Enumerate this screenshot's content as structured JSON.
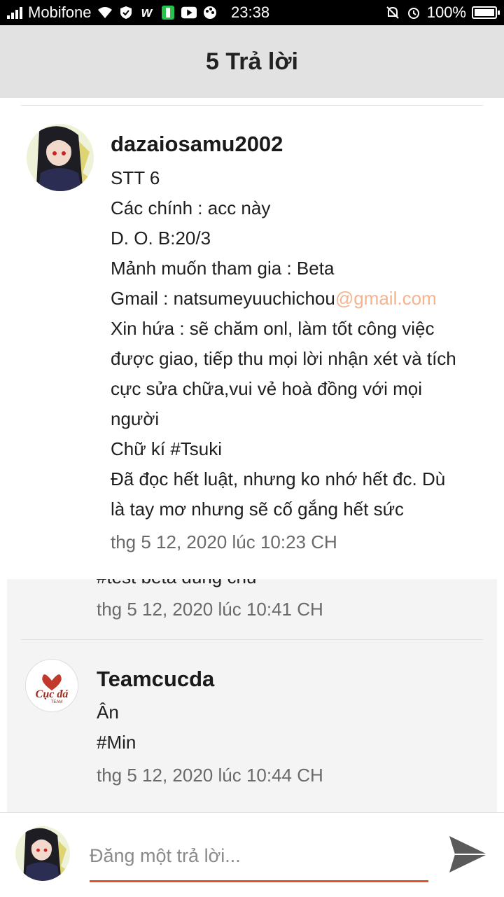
{
  "status_bar": {
    "carrier": "Mobifone",
    "time": "23:38",
    "battery": "100%"
  },
  "header": {
    "title": "5 Trả lời"
  },
  "comments": [
    {
      "author": "dazaiosamu2002",
      "lines": [
        "STT 6",
        "Các chính : acc này",
        "D. O. B:20/3",
        "Mảnh muốn tham gia : Beta",
        "Xin hứa : sẽ chăm onl, làm tốt công việc",
        "được giao, tiếp thu mọi lời nhận xét và tích",
        "cực sửa chữa,vui vẻ hoà đồng với mọi",
        "người",
        "Chữ kí #Tsuki",
        "Đã đọc hết luật, nhưng ko nhớ hết đc. Dù",
        "là tay mơ nhưng sẽ cố gắng hết sức"
      ],
      "email_prefix": "Gmail : natsumeyuuchichou",
      "email_domain": "@gmail.com",
      "date": "thg 5 12, 2020 lúc 10:23 CH"
    },
    {
      "partial_text": "#test beta dùng chủ",
      "date": "thg 5 12, 2020 lúc 10:41 CH"
    },
    {
      "author": "Teamcucda",
      "avatar_text": "Cục đá",
      "avatar_subtext": "TEAM",
      "lines": [
        "Ân",
        "#Min"
      ],
      "date": "thg 5 12, 2020 lúc 10:44 CH"
    }
  ],
  "reply": {
    "placeholder": "Đăng một trả lời..."
  },
  "colors": {
    "accent": "#e2531f",
    "link": "#f3b48f",
    "header_bg": "#e2e2e2"
  }
}
